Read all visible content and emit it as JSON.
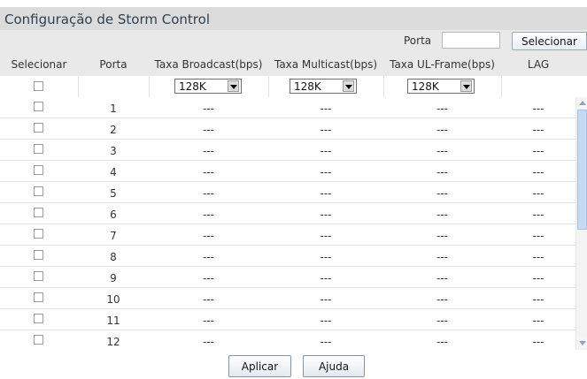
{
  "title": "Configuração de Storm Control",
  "filter": {
    "label": "Porta",
    "value": "",
    "button_label": "Selecionar"
  },
  "columns": {
    "select": "Selecionar",
    "port": "Porta",
    "broadcast": "Taxa Broadcast(bps)",
    "multicast": "Taxa Multicast(bps)",
    "ul_frame": "Taxa UL-Frame(bps)",
    "lag": "LAG"
  },
  "settings": {
    "broadcast": "128K",
    "multicast": "128K",
    "ul_frame": "128K"
  },
  "rows": [
    {
      "port": "1",
      "broadcast": "---",
      "multicast": "---",
      "ul_frame": "---",
      "lag": "---"
    },
    {
      "port": "2",
      "broadcast": "---",
      "multicast": "---",
      "ul_frame": "---",
      "lag": "---"
    },
    {
      "port": "3",
      "broadcast": "---",
      "multicast": "---",
      "ul_frame": "---",
      "lag": "---"
    },
    {
      "port": "4",
      "broadcast": "---",
      "multicast": "---",
      "ul_frame": "---",
      "lag": "---"
    },
    {
      "port": "5",
      "broadcast": "---",
      "multicast": "---",
      "ul_frame": "---",
      "lag": "---"
    },
    {
      "port": "6",
      "broadcast": "---",
      "multicast": "---",
      "ul_frame": "---",
      "lag": "---"
    },
    {
      "port": "7",
      "broadcast": "---",
      "multicast": "---",
      "ul_frame": "---",
      "lag": "---"
    },
    {
      "port": "8",
      "broadcast": "---",
      "multicast": "---",
      "ul_frame": "---",
      "lag": "---"
    },
    {
      "port": "9",
      "broadcast": "---",
      "multicast": "---",
      "ul_frame": "---",
      "lag": "---"
    },
    {
      "port": "10",
      "broadcast": "---",
      "multicast": "---",
      "ul_frame": "---",
      "lag": "---"
    },
    {
      "port": "11",
      "broadcast": "---",
      "multicast": "---",
      "ul_frame": "---",
      "lag": "---"
    },
    {
      "port": "12",
      "broadcast": "---",
      "multicast": "---",
      "ul_frame": "---",
      "lag": "---"
    }
  ],
  "buttons": {
    "apply": "Aplicar",
    "help": "Ajuda"
  },
  "colors": {
    "title_bg": "#dcdcdc",
    "header_bg": "#e9e9e9",
    "title_text": "#2e4150",
    "scroll_thumb": "#c8d8ee"
  }
}
